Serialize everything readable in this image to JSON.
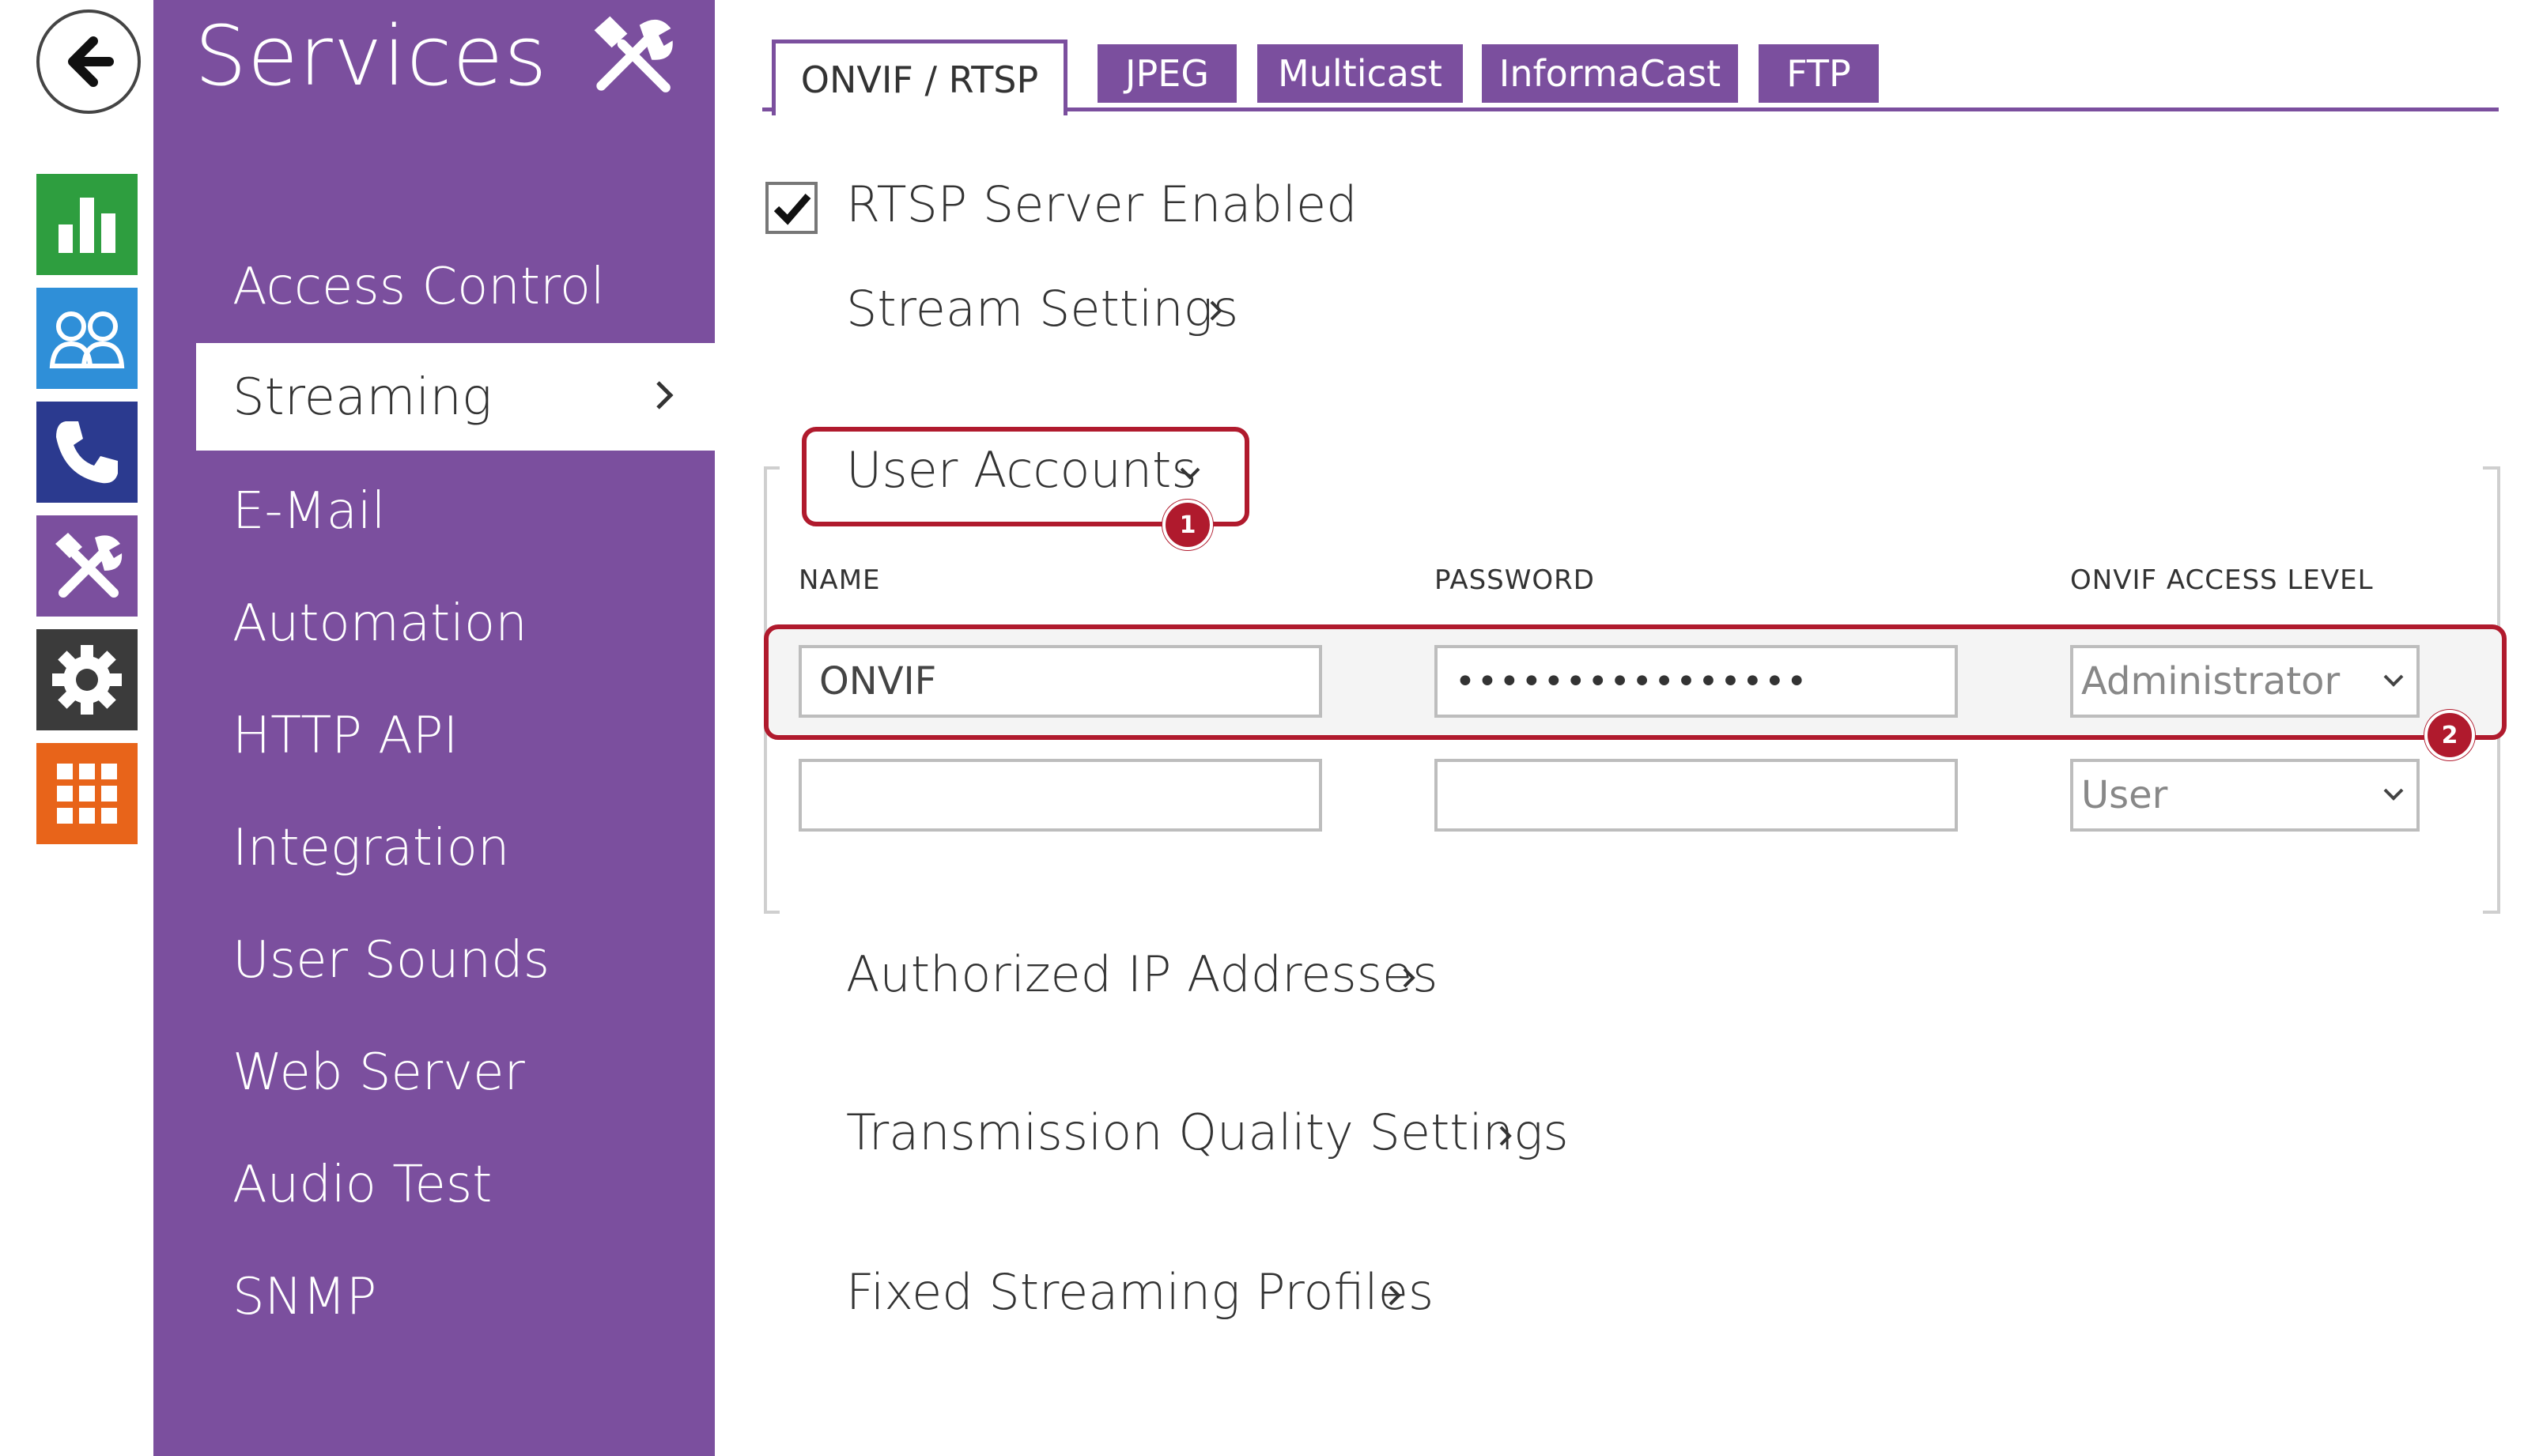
{
  "rail": {
    "icons": [
      "back-arrow-icon",
      "status-chart-icon",
      "directory-users-icon",
      "phone-icon",
      "services-tools-icon",
      "gear-icon",
      "apps-grid-icon"
    ],
    "colors": {
      "status": "#2e9e3f",
      "directory": "#2f8fd8",
      "phone": "#2b3a8f",
      "services": "#7b4f9e",
      "settings": "#3b3b3b",
      "apps": "#e8641a"
    }
  },
  "sidebar": {
    "title": "Services",
    "accent": "#7b4f9e",
    "items": [
      {
        "label": "Access Control"
      },
      {
        "label": "Streaming",
        "active": true
      },
      {
        "label": "E-Mail"
      },
      {
        "label": "Automation"
      },
      {
        "label": "HTTP API"
      },
      {
        "label": "Integration"
      },
      {
        "label": "User Sounds"
      },
      {
        "label": "Web Server"
      },
      {
        "label": "Audio Test"
      },
      {
        "label": "SNMP"
      }
    ]
  },
  "tabs": [
    {
      "label": "ONVIF / RTSP",
      "active": true
    },
    {
      "label": "JPEG"
    },
    {
      "label": "Multicast"
    },
    {
      "label": "InformaCast"
    },
    {
      "label": "FTP"
    }
  ],
  "main": {
    "rtsp_enabled_label": "RTSP Server Enabled",
    "rtsp_enabled": true,
    "stream_settings": "Stream Settings",
    "user_accounts": "User Accounts",
    "columns": {
      "name": "NAME",
      "password": "PASSWORD",
      "access": "ONVIF ACCESS LEVEL"
    },
    "rows": [
      {
        "name": "ONVIF",
        "password": "••••••••••••••••",
        "access": "Administrator"
      },
      {
        "name": "",
        "password": "",
        "access": "User"
      }
    ],
    "authorized_ip": "Authorized IP Addresses",
    "transmission_quality": "Transmission Quality Settings",
    "fixed_profiles": "Fixed Streaming Profiles"
  },
  "callouts": {
    "one": "1",
    "two": "2",
    "color": "#b01a2d"
  }
}
